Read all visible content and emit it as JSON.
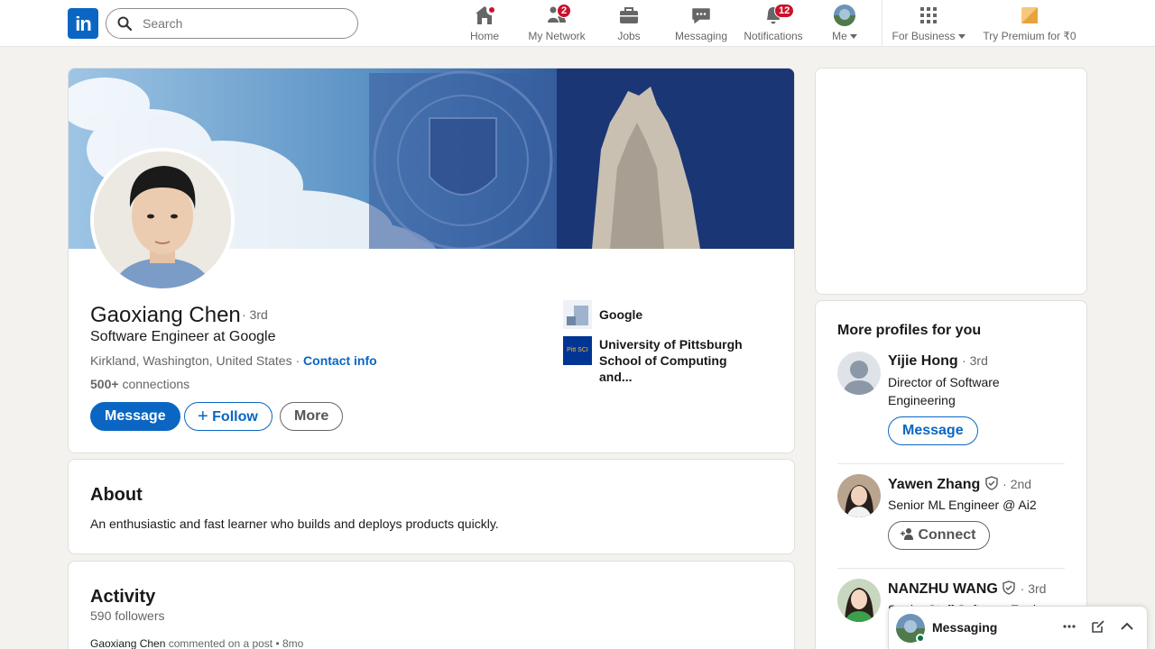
{
  "nav": {
    "logo_text": "in",
    "search_placeholder": "Search",
    "items": [
      {
        "label": "Home",
        "icon": "home-icon",
        "badge": "dot"
      },
      {
        "label": "My Network",
        "icon": "network-icon",
        "badge": "2"
      },
      {
        "label": "Jobs",
        "icon": "briefcase-icon",
        "badge": ""
      },
      {
        "label": "Messaging",
        "icon": "messaging-icon",
        "badge": ""
      },
      {
        "label": "Notifications",
        "icon": "bell-icon",
        "badge": "12"
      },
      {
        "label": "Me",
        "icon": "avatar",
        "badge": ""
      },
      {
        "label": "For Business",
        "icon": "grid-icon",
        "badge": ""
      },
      {
        "label": "Try Premium for ₹0",
        "icon": "premium-icon",
        "badge": ""
      }
    ]
  },
  "profile": {
    "name": "Gaoxiang Chen",
    "degree": "· 3rd",
    "headline": "Software Engineer at Google",
    "location": "Kirkland, Washington, United States ·",
    "contact_info": "Contact info",
    "connections_count": "500+",
    "connections_label": "connections",
    "buttons": {
      "message": "Message",
      "follow": "Follow",
      "more": "More"
    },
    "orgs": [
      {
        "name": "Google"
      },
      {
        "name": "University of Pittsburgh School of Computing and...",
        "logo_text": "Pitt SCI"
      }
    ]
  },
  "about": {
    "title": "About",
    "text": "An enthusiastic and fast learner who builds and deploys products quickly."
  },
  "activity": {
    "title": "Activity",
    "followers": "590 followers",
    "post_author": "Gaoxiang Chen",
    "post_meta": "commented on a post • 8mo"
  },
  "rail": {
    "title": "More profiles for you",
    "people": [
      {
        "name": "Yijie Hong",
        "degree": "· 3rd",
        "headline": "Director of Software Engineering",
        "action": "Message"
      },
      {
        "name": "Yawen Zhang",
        "degree": "· 2nd",
        "headline": "Senior ML Engineer @ Ai2",
        "action": "Connect"
      },
      {
        "name": "NANZHU WANG",
        "degree": "· 3rd",
        "headline": "Senior Staff Software Engineer"
      }
    ]
  },
  "messaging": {
    "label": "Messaging"
  },
  "colors": {
    "brand": "#0a66c2",
    "badge": "#cb112d",
    "background": "#f4f2ee"
  }
}
